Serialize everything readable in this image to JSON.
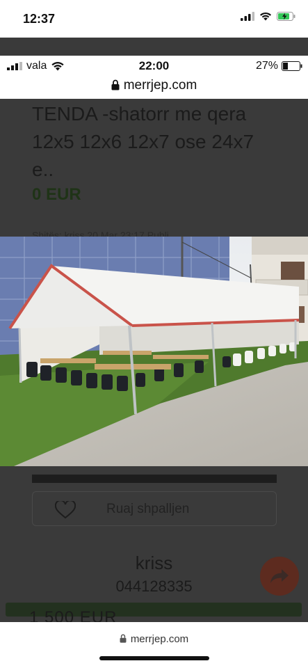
{
  "outer_status": {
    "time": "12:37",
    "icons": [
      "signal-icon",
      "wifi-icon",
      "battery-charging-icon"
    ],
    "battery_color": "#35c759"
  },
  "inner_status": {
    "carrier": "vala",
    "time": "22:00",
    "battery": "27%"
  },
  "inner_browser": {
    "domain": "merrjep.com"
  },
  "listing": {
    "title": "TENDA -shatorr me qera 12x5 12x6 12x7 ose 24x7 e..",
    "price": "0 EUR",
    "meta": "Shitës: kriss   20 Mar 23:17   Publi",
    "price_color": "#1f3317"
  },
  "actions": {
    "save_label": "Ruaj shpalljen"
  },
  "seller": {
    "name": "kriss",
    "phone": "044128335"
  },
  "peek": {
    "price": "1 500 EUR"
  },
  "bottom_browser": {
    "domain": "merrjep.com"
  },
  "colors": {
    "overlay": "#3a3a3a",
    "share_button": "#5d2b1f",
    "green_bar": "#23311f"
  }
}
